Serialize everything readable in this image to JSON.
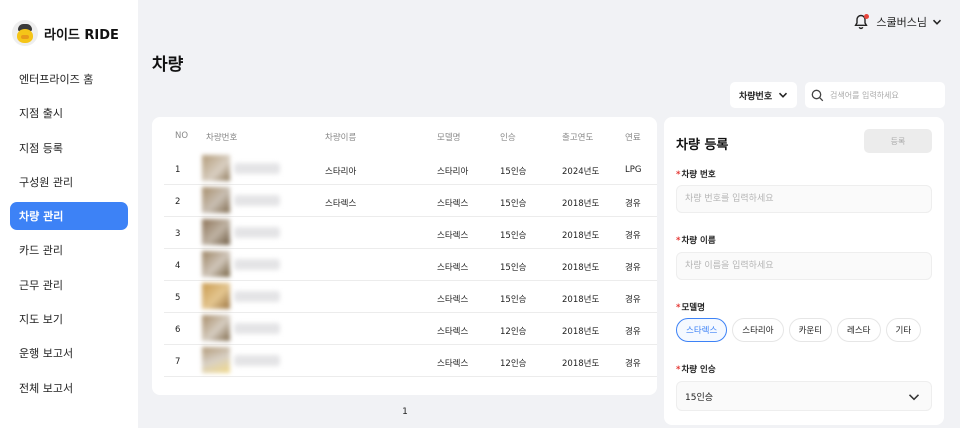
{
  "brand": {
    "name": "라이드 RIDE"
  },
  "sidebar": {
    "items": [
      {
        "label": "엔터프라이즈 홈"
      },
      {
        "label": "지점 출시"
      },
      {
        "label": "지점 등록"
      },
      {
        "label": "구성원 관리"
      },
      {
        "label": "차량 관리",
        "active": true
      },
      {
        "label": "카드 관리"
      },
      {
        "label": "근무 관리"
      },
      {
        "label": "지도 보기"
      },
      {
        "label": "운행 보고서"
      },
      {
        "label": "전체 보고서"
      }
    ]
  },
  "header": {
    "user_name": "스쿨버스님",
    "has_notification": true
  },
  "page": {
    "title": "차량"
  },
  "filter": {
    "select_value": "차량번호",
    "search_placeholder": "검색어를 입력하세요"
  },
  "table": {
    "columns": [
      "NO",
      "차량번호",
      "차량이름",
      "모델명",
      "인승",
      "출고연도",
      "연료"
    ],
    "rows": [
      {
        "no": "1",
        "plate": "",
        "name": "스타리아",
        "model": "스타리아",
        "seats": "15인승",
        "year": "2024년도",
        "fuel": "LPG"
      },
      {
        "no": "2",
        "plate": "",
        "name": "스타렉스",
        "model": "스타렉스",
        "seats": "15인승",
        "year": "2018년도",
        "fuel": "경유"
      },
      {
        "no": "3",
        "plate": "",
        "name": "",
        "model": "스타렉스",
        "seats": "15인승",
        "year": "2018년도",
        "fuel": "경유"
      },
      {
        "no": "4",
        "plate": "",
        "name": "",
        "model": "스타렉스",
        "seats": "15인승",
        "year": "2018년도",
        "fuel": "경유"
      },
      {
        "no": "5",
        "plate": "",
        "name": "",
        "model": "스타렉스",
        "seats": "15인승",
        "year": "2018년도",
        "fuel": "경유"
      },
      {
        "no": "6",
        "plate": "",
        "name": "",
        "model": "스타렉스",
        "seats": "12인승",
        "year": "2018년도",
        "fuel": "경유"
      },
      {
        "no": "7",
        "plate": "",
        "name": "",
        "model": "스타렉스",
        "seats": "12인승",
        "year": "2018년도",
        "fuel": "경유"
      }
    ]
  },
  "pagination": {
    "current": "1"
  },
  "registration": {
    "title": "차량 등록",
    "submit_label": "등록",
    "plate_label": "차량 번호",
    "plate_placeholder": "차량 번호를 입력하세요",
    "name_label": "차량 이름",
    "name_placeholder": "차량 이름을 입력하세요",
    "model_label": "모델명",
    "model_options": [
      "스타렉스",
      "스타리아",
      "카운티",
      "레스타",
      "기타"
    ],
    "model_selected": "스타렉스",
    "seats_label": "차량 인승",
    "seats_value": "15인승"
  },
  "colors": {
    "accent": "#3d82f6",
    "required": "#e53935",
    "background": "#f1f2f5"
  }
}
